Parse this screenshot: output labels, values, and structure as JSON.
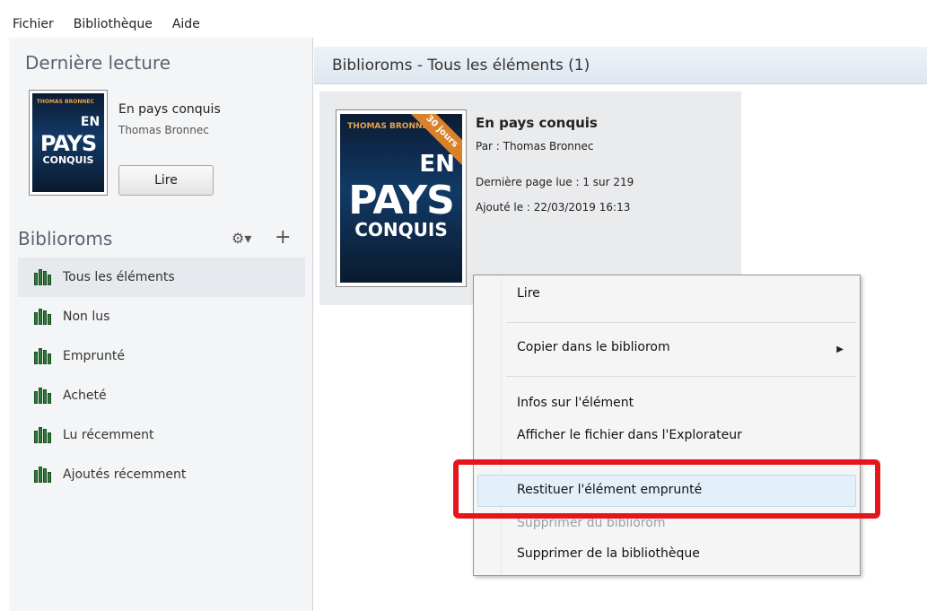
{
  "menubar": {
    "file": "Fichier",
    "library": "Bibliothèque",
    "help": "Aide"
  },
  "sidebar": {
    "last_read_title": "Dernière lecture",
    "recent": {
      "title": "En pays conquis",
      "author": "Thomas Bronnec",
      "read_label": "Lire"
    },
    "collections_title": "Biblioroms",
    "items": [
      {
        "label": "Tous les éléments",
        "active": true
      },
      {
        "label": "Non lus"
      },
      {
        "label": "Emprunté"
      },
      {
        "label": "Acheté"
      },
      {
        "label": "Lu récemment"
      },
      {
        "label": "Ajoutés récemment"
      }
    ]
  },
  "main": {
    "header": "Biblioroms - Tous les éléments (1)",
    "book": {
      "title": "En pays conquis",
      "by": "Par :  Thomas Bronnec",
      "last_page": "Dernière page lue :  1 sur 219",
      "added": "Ajouté le :  22/03/2019 16:13",
      "ribbon": "30 jours",
      "cover_en": "EN",
      "cover_pays": "PAYS",
      "cover_conquis": "CONQUIS",
      "cover_author": "THOMAS BRONNEC"
    }
  },
  "context_menu": {
    "read": "Lire",
    "copy": "Copier dans le bibliorom",
    "info": "Infos sur l'élément",
    "show_file": "Afficher le fichier dans l'Explorateur",
    "return_loan": "Restituer l'élément emprunté",
    "remove_biblio": "Supprimer du bibliorom",
    "remove_library": "Supprimer de la bibliothèque"
  },
  "colors": {
    "highlight": "#e5161b",
    "ribbon": "#d9822b",
    "hover": "#e3f0f9"
  }
}
